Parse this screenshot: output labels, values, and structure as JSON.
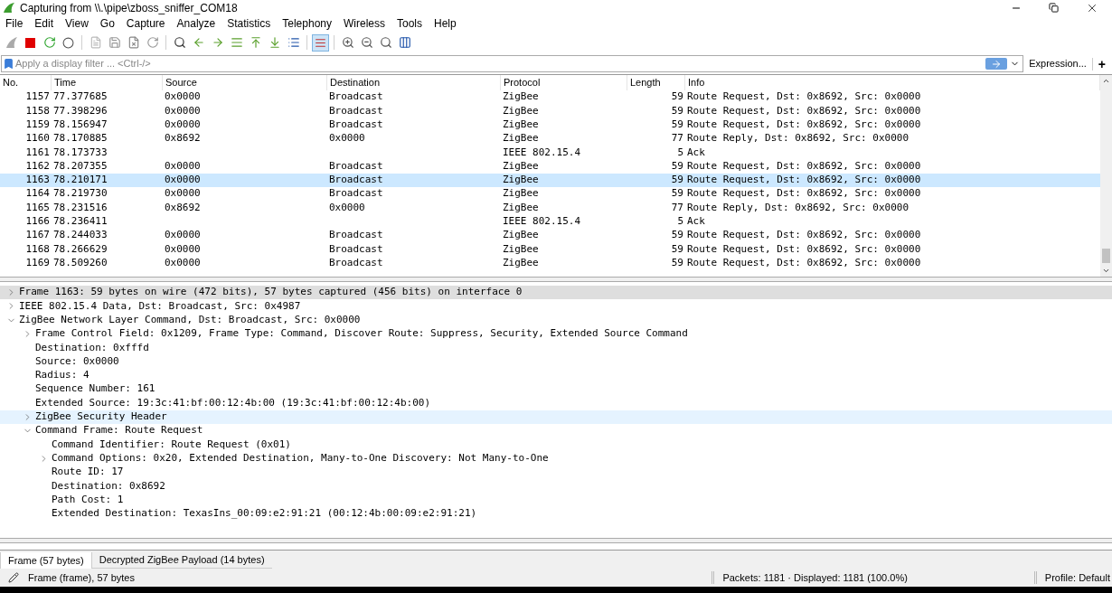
{
  "window": {
    "title": "Capturing from \\\\.\\pipe\\zboss_sniffer_COM18"
  },
  "menu": [
    "File",
    "Edit",
    "View",
    "Go",
    "Capture",
    "Analyze",
    "Statistics",
    "Telephony",
    "Wireless",
    "Tools",
    "Help"
  ],
  "filter": {
    "placeholder": "Apply a display filter ... <Ctrl-/>",
    "expression_label": "Expression...",
    "add_label": "+"
  },
  "packet_list": {
    "columns": [
      "No.",
      "Time",
      "Source",
      "Destination",
      "Protocol",
      "Length",
      "Info"
    ],
    "rows": [
      {
        "no": "1157",
        "time": "77.377685",
        "source": "0x0000",
        "destination": "Broadcast",
        "protocol": "ZigBee",
        "length": "59",
        "info": "Route Request, Dst: 0x8692, Src: 0x0000",
        "selected": false
      },
      {
        "no": "1158",
        "time": "77.398296",
        "source": "0x0000",
        "destination": "Broadcast",
        "protocol": "ZigBee",
        "length": "59",
        "info": "Route Request, Dst: 0x8692, Src: 0x0000",
        "selected": false
      },
      {
        "no": "1159",
        "time": "78.156947",
        "source": "0x0000",
        "destination": "Broadcast",
        "protocol": "ZigBee",
        "length": "59",
        "info": "Route Request, Dst: 0x8692, Src: 0x0000",
        "selected": false
      },
      {
        "no": "1160",
        "time": "78.170885",
        "source": "0x8692",
        "destination": "0x0000",
        "protocol": "ZigBee",
        "length": "77",
        "info": "Route Reply, Dst: 0x8692, Src: 0x0000",
        "selected": false
      },
      {
        "no": "1161",
        "time": "78.173733",
        "protocol": "IEEE 802.15.4",
        "length": "5",
        "info": "Ack",
        "selected": false
      },
      {
        "no": "1162",
        "time": "78.207355",
        "source": "0x0000",
        "destination": "Broadcast",
        "protocol": "ZigBee",
        "length": "59",
        "info": "Route Request, Dst: 0x8692, Src: 0x0000",
        "selected": false
      },
      {
        "no": "1163",
        "time": "78.210171",
        "source": "0x0000",
        "destination": "Broadcast",
        "protocol": "ZigBee",
        "length": "59",
        "info": "Route Request, Dst: 0x8692, Src: 0x0000",
        "selected": true
      },
      {
        "no": "1164",
        "time": "78.219730",
        "source": "0x0000",
        "destination": "Broadcast",
        "protocol": "ZigBee",
        "length": "59",
        "info": "Route Request, Dst: 0x8692, Src: 0x0000",
        "selected": false
      },
      {
        "no": "1165",
        "time": "78.231516",
        "source": "0x8692",
        "destination": "0x0000",
        "protocol": "ZigBee",
        "length": "77",
        "info": "Route Reply, Dst: 0x8692, Src: 0x0000",
        "selected": false
      },
      {
        "no": "1166",
        "time": "78.236411",
        "protocol": "IEEE 802.15.4",
        "length": "5",
        "info": "Ack",
        "selected": false
      },
      {
        "no": "1167",
        "time": "78.244033",
        "source": "0x0000",
        "destination": "Broadcast",
        "protocol": "ZigBee",
        "length": "59",
        "info": "Route Request, Dst: 0x8692, Src: 0x0000",
        "selected": false
      },
      {
        "no": "1168",
        "time": "78.266629",
        "source": "0x0000",
        "destination": "Broadcast",
        "protocol": "ZigBee",
        "length": "59",
        "info": "Route Request, Dst: 0x8692, Src: 0x0000",
        "selected": false
      },
      {
        "no": "1169",
        "time": "78.509260",
        "source": "0x0000",
        "destination": "Broadcast",
        "protocol": "ZigBee",
        "length": "59",
        "info": "Route Request, Dst: 0x8692, Src: 0x0000",
        "selected": false
      }
    ]
  },
  "packet_details": [
    {
      "text": "Frame 1163: 59 bytes on wire (472 bits), 57 bytes captured (456 bits) on interface 0",
      "expanded": false,
      "selected": true,
      "hovered": false
    },
    {
      "text": "IEEE 802.15.4 Data, Dst: Broadcast, Src: 0x4987",
      "expanded": false,
      "selected": false,
      "hovered": false
    },
    {
      "text": "ZigBee Network Layer Command, Dst: Broadcast, Src: 0x0000",
      "expanded": true,
      "selected": false,
      "hovered": false,
      "children": [
        {
          "text": "Frame Control Field: 0x1209, Frame Type: Command, Discover Route: Suppress, Security, Extended Source Command",
          "expanded": false,
          "selected": false,
          "hovered": false
        },
        {
          "text": "Destination: 0xfffd",
          "selected": false,
          "hovered": false
        },
        {
          "text": "Source: 0x0000",
          "selected": false,
          "hovered": false
        },
        {
          "text": "Radius: 4",
          "selected": false,
          "hovered": false
        },
        {
          "text": "Sequence Number: 161",
          "selected": false,
          "hovered": false
        },
        {
          "text": "Extended Source: 19:3c:41:bf:00:12:4b:00 (19:3c:41:bf:00:12:4b:00)",
          "selected": false,
          "hovered": false
        },
        {
          "text": "ZigBee Security Header",
          "expanded": false,
          "selected": false,
          "hovered": true
        },
        {
          "text": "Command Frame: Route Request",
          "expanded": true,
          "selected": false,
          "hovered": false,
          "children": [
            {
              "text": "Command Identifier: Route Request (0x01)",
              "selected": false,
              "hovered": false
            },
            {
              "text": "Command Options: 0x20, Extended Destination, Many-to-One Discovery: Not Many-to-One",
              "expanded": false,
              "selected": false,
              "hovered": false
            },
            {
              "text": "Route ID: 17",
              "selected": false,
              "hovered": false
            },
            {
              "text": "Destination: 0x8692",
              "selected": false,
              "hovered": false
            },
            {
              "text": "Path Cost: 1",
              "selected": false,
              "hovered": false
            },
            {
              "text": "Extended Destination: TexasIns_00:09:e2:91:21 (00:12:4b:00:09:e2:91:21)",
              "selected": false,
              "hovered": false
            }
          ]
        }
      ]
    }
  ],
  "bytes_tabs": [
    {
      "label": "Frame (57 bytes)",
      "selected": true
    },
    {
      "label": "Decrypted ZigBee Payload (14 bytes)",
      "selected": false
    }
  ],
  "status_bar": {
    "field": "Frame (frame), 57 bytes",
    "packets": "Packets: 1181 · Displayed: 1181 (100.0%)",
    "profile": "Profile: Default"
  }
}
